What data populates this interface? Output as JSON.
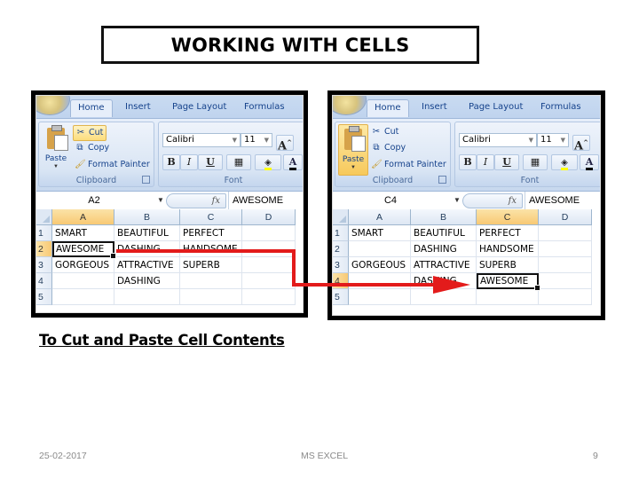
{
  "slide": {
    "title": "WORKING WITH CELLS",
    "subtitle": "To Cut and Paste Cell Contents",
    "footer": {
      "date": "25-02-2017",
      "center": "MS EXCEL",
      "page_number": "9"
    },
    "colors": {
      "arrow": "#e31b1b",
      "selected_header": "#f8c974",
      "ribbon": "#dbe6f3",
      "tab_text": "#15428b"
    }
  },
  "screenshots": [
    {
      "id": "before",
      "tabs": [
        "Home",
        "Insert",
        "Page Layout",
        "Formulas"
      ],
      "clipboard": {
        "paste": "Paste",
        "cut": "Cut",
        "copy": "Copy",
        "format_painter": "Format Painter",
        "group_label": "Clipboard",
        "highlighted": "cut"
      },
      "font": {
        "name": "Calibri",
        "size": "11",
        "group_label": "Font",
        "bold": "B",
        "italic": "I",
        "underline": "U"
      },
      "formula_bar": {
        "name_box": "A2",
        "fx": "fx",
        "value": "AWESOME"
      },
      "columns": [
        "A",
        "B",
        "C",
        "D"
      ],
      "rows": [
        "1",
        "2",
        "3",
        "4",
        "5"
      ],
      "selected_column": "A",
      "selected_row": "2",
      "cells": [
        [
          "SMART",
          "BEAUTIFUL",
          "PERFECT",
          ""
        ],
        [
          "AWESOME",
          "DASHING",
          "HANDSOME",
          ""
        ],
        [
          "GORGEOUS",
          "ATTRACTIVE",
          "SUPERB",
          ""
        ],
        [
          "",
          "DASHING",
          "",
          ""
        ],
        [
          "",
          "",
          "",
          ""
        ]
      ]
    },
    {
      "id": "after",
      "tabs": [
        "Home",
        "Insert",
        "Page Layout",
        "Formulas"
      ],
      "clipboard": {
        "paste": "Paste",
        "cut": "Cut",
        "copy": "Copy",
        "format_painter": "Format Painter",
        "group_label": "Clipboard",
        "highlighted": "paste"
      },
      "font": {
        "name": "Calibri",
        "size": "11",
        "group_label": "Font",
        "bold": "B",
        "italic": "I",
        "underline": "U"
      },
      "formula_bar": {
        "name_box": "C4",
        "fx": "fx",
        "value": "AWESOME"
      },
      "columns": [
        "A",
        "B",
        "C",
        "D"
      ],
      "rows": [
        "1",
        "2",
        "3",
        "4",
        "5"
      ],
      "selected_column": "C",
      "selected_row": "4",
      "cells": [
        [
          "SMART",
          "BEAUTIFUL",
          "PERFECT",
          ""
        ],
        [
          "",
          "DASHING",
          "HANDSOME",
          ""
        ],
        [
          "GORGEOUS",
          "ATTRACTIVE",
          "SUPERB",
          ""
        ],
        [
          "",
          "DASHING",
          "AWESOME",
          ""
        ],
        [
          "",
          "",
          "",
          ""
        ]
      ]
    }
  ]
}
